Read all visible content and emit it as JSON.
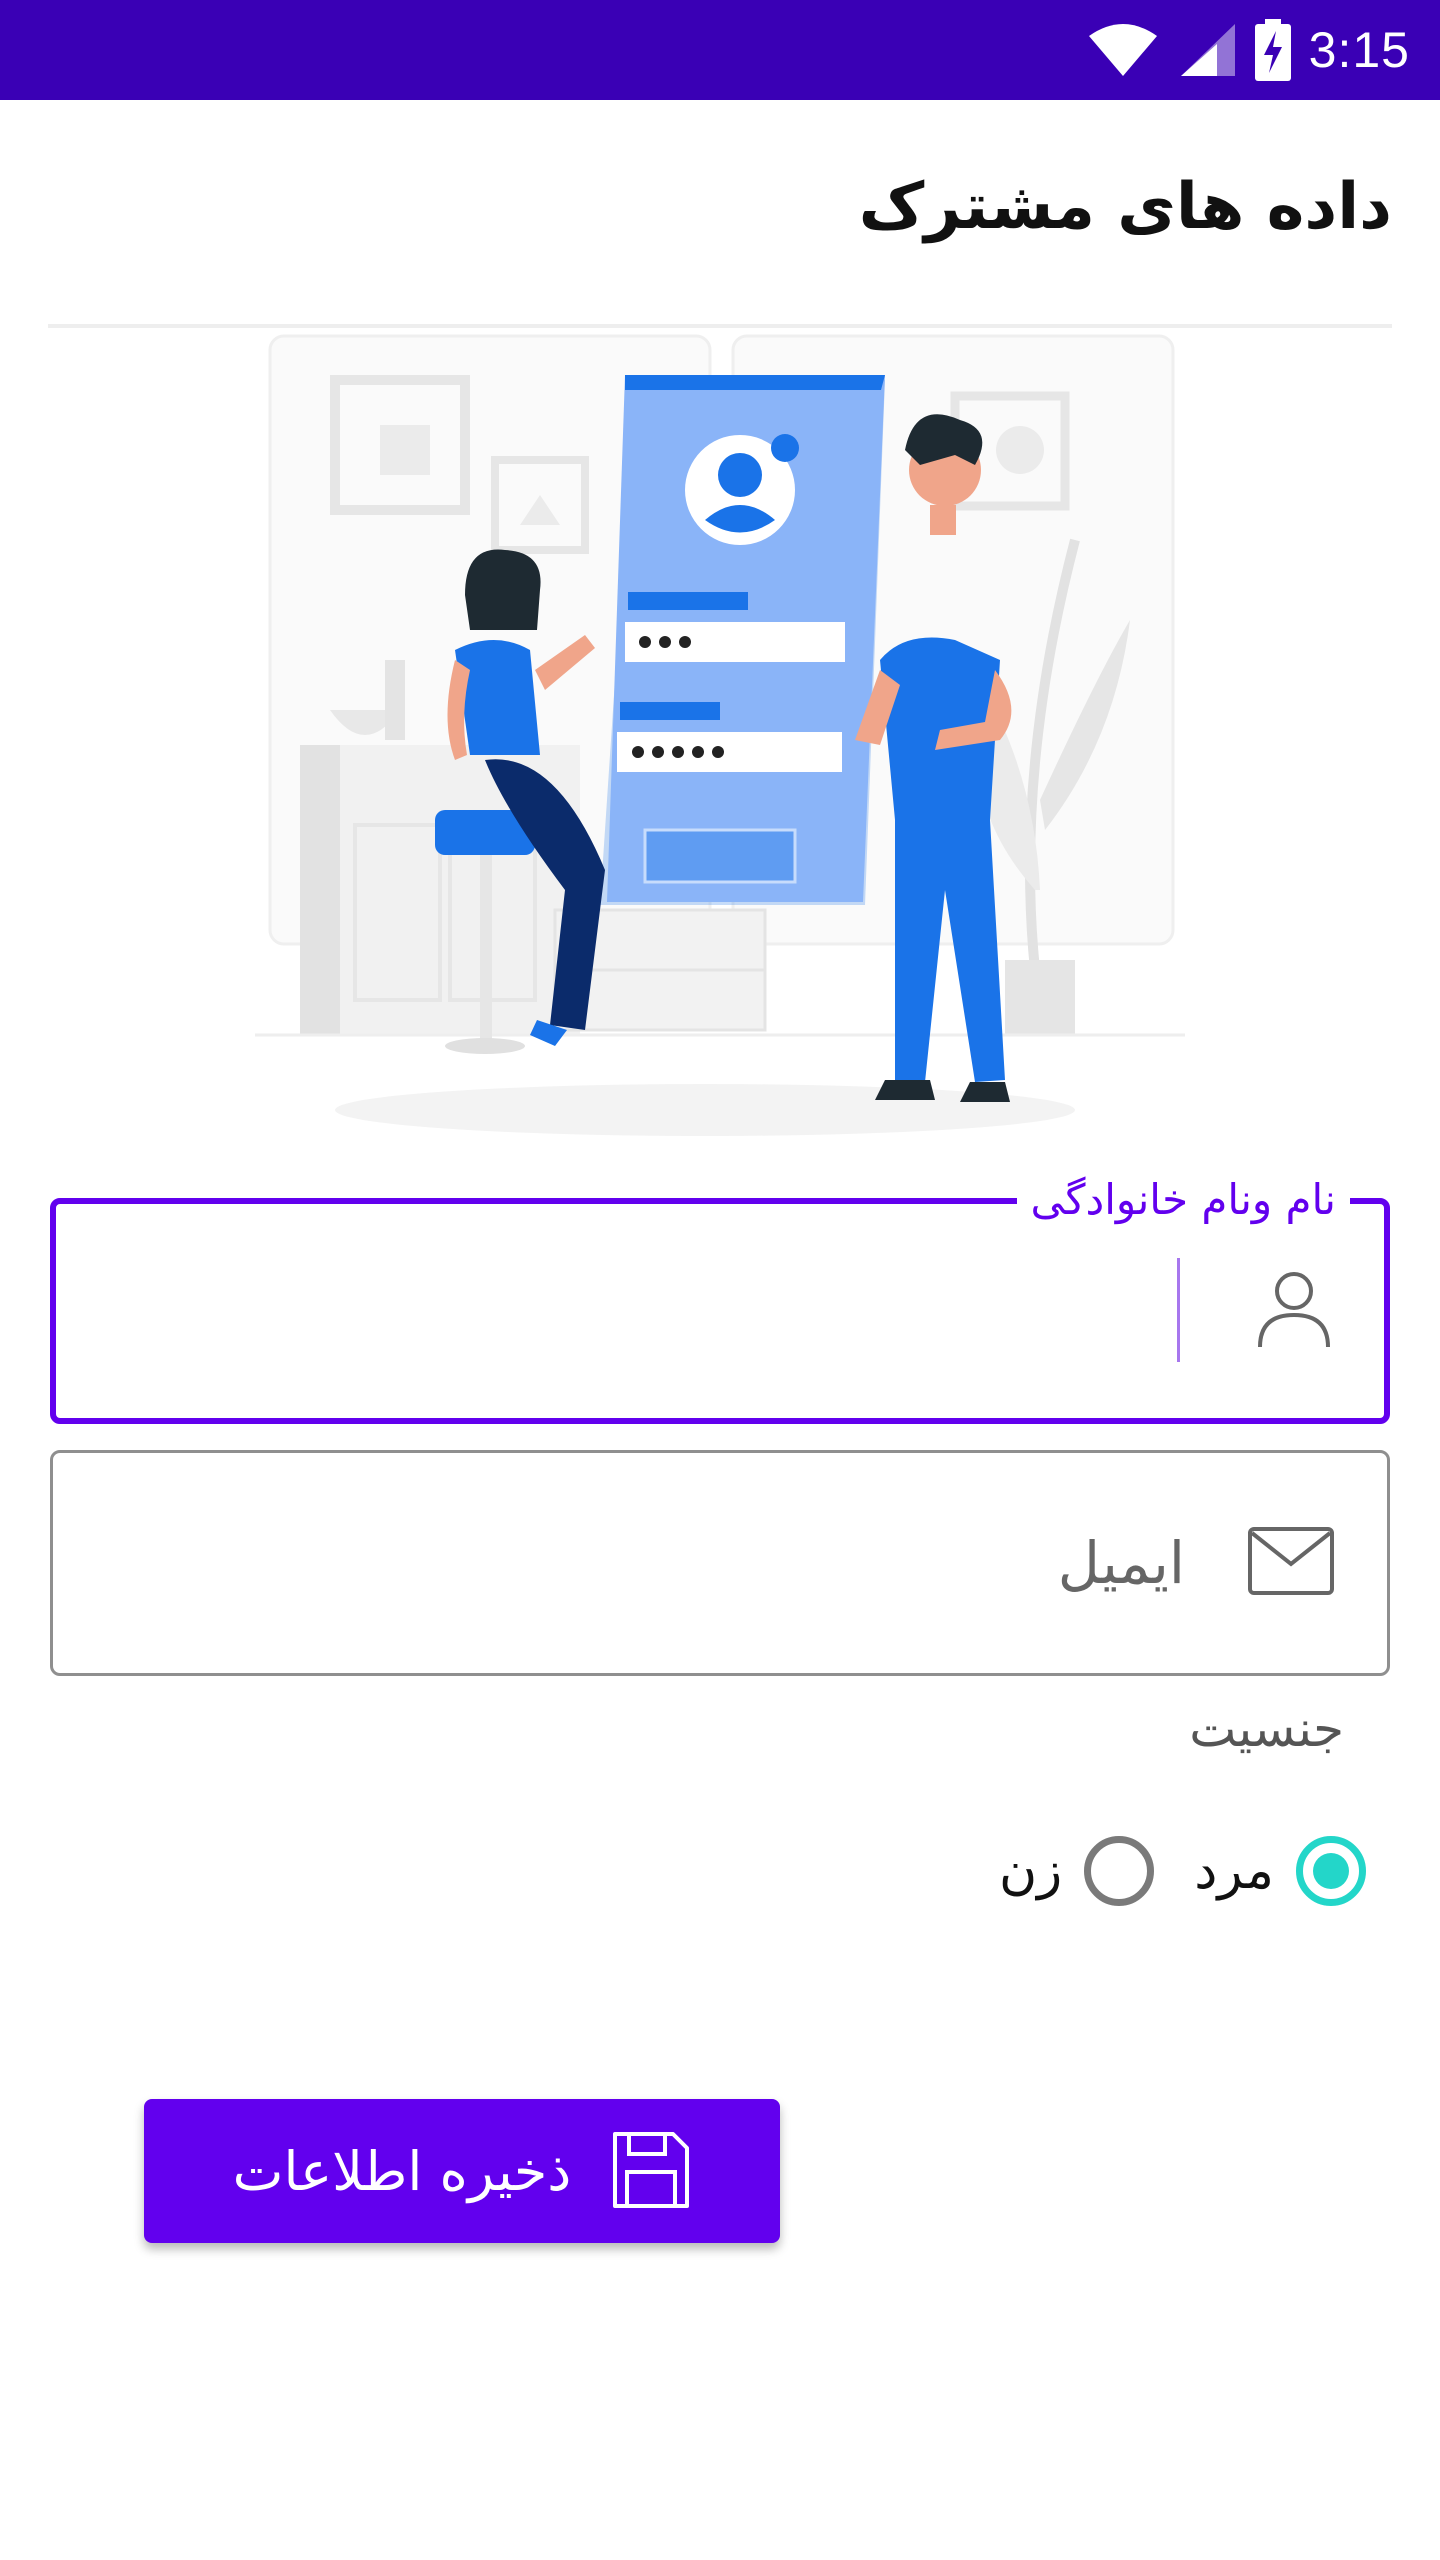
{
  "status_bar": {
    "time": "3:15",
    "icons": [
      "wifi-icon",
      "signal-icon",
      "battery-charging-icon"
    ],
    "color": "#3a00b5"
  },
  "header": {
    "title": "داده های مشترک"
  },
  "form": {
    "name_field": {
      "label": "نام ونام خانوادگی",
      "value": "",
      "icon": "person-icon"
    },
    "email_field": {
      "placeholder": "ایمیل",
      "icon": "mail-icon"
    },
    "gender": {
      "label": "جنسیت",
      "options": [
        {
          "label": "مرد",
          "selected": true
        },
        {
          "label": "زن",
          "selected": false
        }
      ]
    },
    "save_button": {
      "label": "ذخیره اطلاعات",
      "icon": "save-icon"
    }
  },
  "colors": {
    "accent": "#6200ee",
    "radio_selected": "#23d6c9",
    "illustration_blue": "#1a73e8"
  }
}
